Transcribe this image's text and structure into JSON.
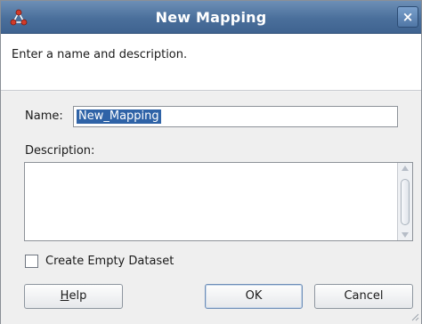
{
  "window": {
    "title": "New Mapping",
    "close_label": "×"
  },
  "header": {
    "instruction": "Enter a name and description."
  },
  "form": {
    "name_label": "Name:",
    "name_value": "New_Mapping",
    "description_label": "Description:",
    "description_value": "",
    "create_empty_dataset_label": "Create Empty Dataset",
    "create_empty_dataset_checked": false
  },
  "buttons": {
    "help_mnemonic": "H",
    "help_rest": "elp",
    "ok_label": "OK",
    "cancel_label": "Cancel"
  },
  "colors": {
    "titlebar": "#4a6f9b",
    "selection": "#2f63a7"
  },
  "icons": {
    "app": "mapping-icon",
    "close": "close-icon",
    "resize": "resize-grip-icon"
  }
}
